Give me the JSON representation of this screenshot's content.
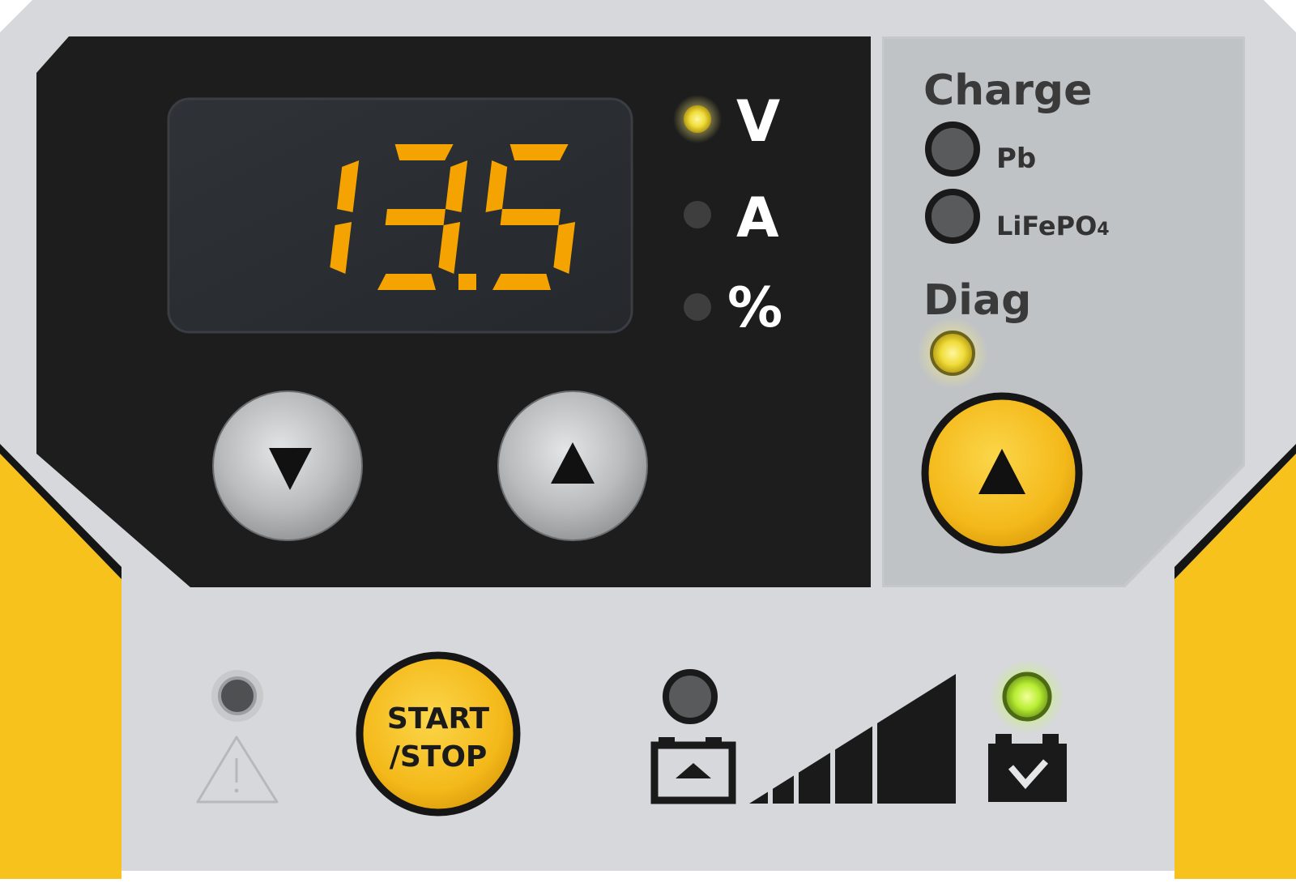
{
  "display": {
    "value": "13.5",
    "digit_color": "#f5a300"
  },
  "units": {
    "v_label": "V",
    "a_label": "A",
    "pct_label": "%",
    "active": "V"
  },
  "charge": {
    "title": "Charge",
    "pb_label": "Pb",
    "lifepo_main": "LiFePO",
    "lifepo_sub": "4"
  },
  "diag": {
    "title": "Diag"
  },
  "start_stop": {
    "line1": "START",
    "line2": "/STOP"
  },
  "status": {
    "warning_led": "off",
    "charging_led": "off",
    "charged_led": "on",
    "charge_level_bars": 5
  },
  "icons": {
    "down": "arrow-down-icon",
    "up": "arrow-up-icon",
    "diag_up": "arrow-up-icon",
    "warning": "warning-triangle-icon",
    "battery_charging": "battery-charging-icon",
    "battery_charged": "battery-check-icon",
    "level": "charge-level-icon"
  },
  "colors": {
    "yellow": "#f7c21c",
    "panel_dark": "#1d1d1d",
    "panel_light": "#d6d8db",
    "led_yellow": "#f2e34a",
    "led_green": "#b8f23a",
    "led_off": "#4a4a4a"
  }
}
